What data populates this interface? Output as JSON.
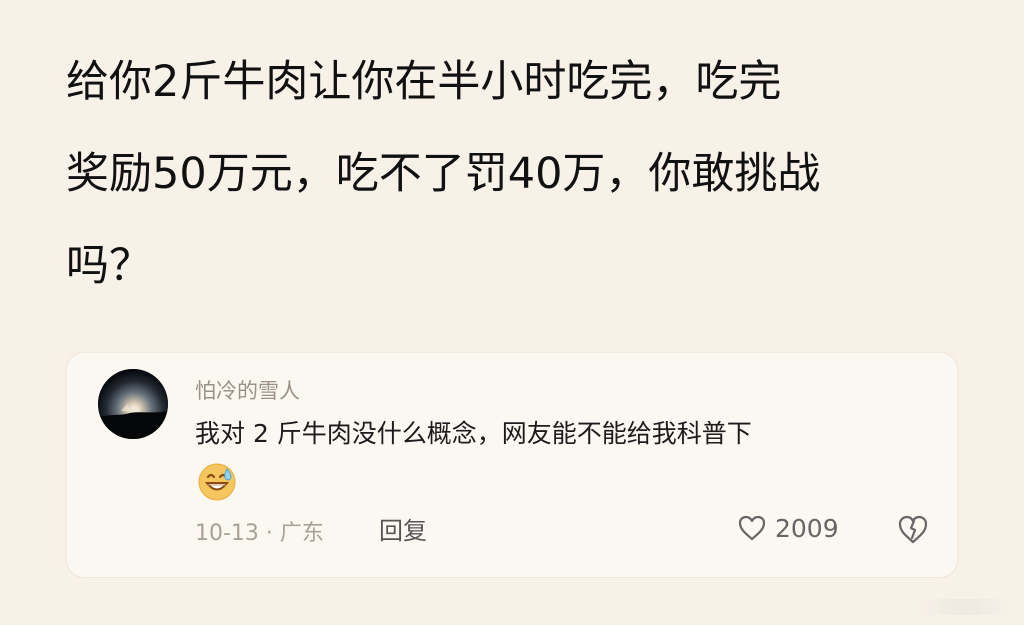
{
  "post": {
    "question_lines": [
      "给你2斤牛肉让你在半小时吃完，吃完",
      "奖励50万元，吃不了罚40万，你敢挑战",
      "吗？"
    ]
  },
  "comment": {
    "username": "怕冷的雪人",
    "text": "我对 2 斤牛肉没什么概念，网友能不能给我科普下",
    "emoji_icon": "grinning-sweat-emoji-icon",
    "date_location": "10-13 · 广东",
    "reply_label": "回复",
    "likes": "2009",
    "heart_icon": "heart-icon",
    "dislike_icon": "broken-heart-icon"
  },
  "colors": {
    "background": "#f8f1e8",
    "card": "#fbf7f1",
    "text": "#111111",
    "muted": "#aaa197",
    "emoji_yellow": "#f4c65d"
  }
}
